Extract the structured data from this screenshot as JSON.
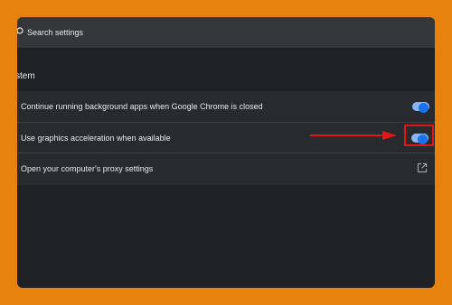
{
  "search": {
    "placeholder": "Search settings"
  },
  "section": {
    "title": "stem"
  },
  "rows": [
    {
      "label": "Continue running background apps when Google Chrome is closed",
      "toggle_on": true
    },
    {
      "label": "Use graphics acceleration when available",
      "toggle_on": true
    },
    {
      "label": "Open your computer's proxy settings",
      "icon": "external-link-icon"
    }
  ],
  "colors": {
    "page_background": "#e8820e",
    "panel_background": "#202124",
    "card_background": "#292a2d",
    "toggle_accent": "#8ab4f8",
    "annotation_red": "#e01515"
  }
}
